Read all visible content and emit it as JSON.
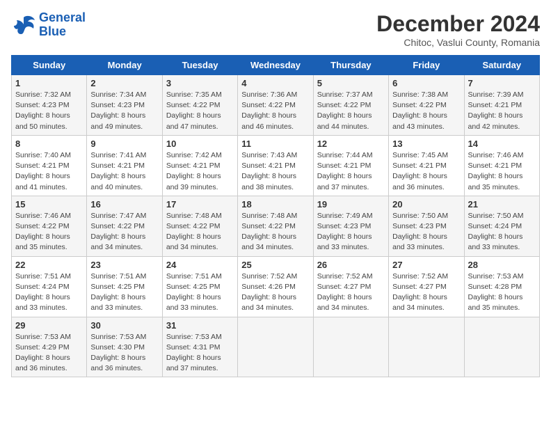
{
  "header": {
    "logo_line1": "General",
    "logo_line2": "Blue",
    "month": "December 2024",
    "location": "Chitoc, Vaslui County, Romania"
  },
  "days_of_week": [
    "Sunday",
    "Monday",
    "Tuesday",
    "Wednesday",
    "Thursday",
    "Friday",
    "Saturday"
  ],
  "weeks": [
    [
      {
        "num": "1",
        "info": "Sunrise: 7:32 AM\nSunset: 4:23 PM\nDaylight: 8 hours\nand 50 minutes."
      },
      {
        "num": "2",
        "info": "Sunrise: 7:34 AM\nSunset: 4:23 PM\nDaylight: 8 hours\nand 49 minutes."
      },
      {
        "num": "3",
        "info": "Sunrise: 7:35 AM\nSunset: 4:22 PM\nDaylight: 8 hours\nand 47 minutes."
      },
      {
        "num": "4",
        "info": "Sunrise: 7:36 AM\nSunset: 4:22 PM\nDaylight: 8 hours\nand 46 minutes."
      },
      {
        "num": "5",
        "info": "Sunrise: 7:37 AM\nSunset: 4:22 PM\nDaylight: 8 hours\nand 44 minutes."
      },
      {
        "num": "6",
        "info": "Sunrise: 7:38 AM\nSunset: 4:22 PM\nDaylight: 8 hours\nand 43 minutes."
      },
      {
        "num": "7",
        "info": "Sunrise: 7:39 AM\nSunset: 4:21 PM\nDaylight: 8 hours\nand 42 minutes."
      }
    ],
    [
      {
        "num": "8",
        "info": "Sunrise: 7:40 AM\nSunset: 4:21 PM\nDaylight: 8 hours\nand 41 minutes."
      },
      {
        "num": "9",
        "info": "Sunrise: 7:41 AM\nSunset: 4:21 PM\nDaylight: 8 hours\nand 40 minutes."
      },
      {
        "num": "10",
        "info": "Sunrise: 7:42 AM\nSunset: 4:21 PM\nDaylight: 8 hours\nand 39 minutes."
      },
      {
        "num": "11",
        "info": "Sunrise: 7:43 AM\nSunset: 4:21 PM\nDaylight: 8 hours\nand 38 minutes."
      },
      {
        "num": "12",
        "info": "Sunrise: 7:44 AM\nSunset: 4:21 PM\nDaylight: 8 hours\nand 37 minutes."
      },
      {
        "num": "13",
        "info": "Sunrise: 7:45 AM\nSunset: 4:21 PM\nDaylight: 8 hours\nand 36 minutes."
      },
      {
        "num": "14",
        "info": "Sunrise: 7:46 AM\nSunset: 4:21 PM\nDaylight: 8 hours\nand 35 minutes."
      }
    ],
    [
      {
        "num": "15",
        "info": "Sunrise: 7:46 AM\nSunset: 4:22 PM\nDaylight: 8 hours\nand 35 minutes."
      },
      {
        "num": "16",
        "info": "Sunrise: 7:47 AM\nSunset: 4:22 PM\nDaylight: 8 hours\nand 34 minutes."
      },
      {
        "num": "17",
        "info": "Sunrise: 7:48 AM\nSunset: 4:22 PM\nDaylight: 8 hours\nand 34 minutes."
      },
      {
        "num": "18",
        "info": "Sunrise: 7:48 AM\nSunset: 4:22 PM\nDaylight: 8 hours\nand 34 minutes."
      },
      {
        "num": "19",
        "info": "Sunrise: 7:49 AM\nSunset: 4:23 PM\nDaylight: 8 hours\nand 33 minutes."
      },
      {
        "num": "20",
        "info": "Sunrise: 7:50 AM\nSunset: 4:23 PM\nDaylight: 8 hours\nand 33 minutes."
      },
      {
        "num": "21",
        "info": "Sunrise: 7:50 AM\nSunset: 4:24 PM\nDaylight: 8 hours\nand 33 minutes."
      }
    ],
    [
      {
        "num": "22",
        "info": "Sunrise: 7:51 AM\nSunset: 4:24 PM\nDaylight: 8 hours\nand 33 minutes."
      },
      {
        "num": "23",
        "info": "Sunrise: 7:51 AM\nSunset: 4:25 PM\nDaylight: 8 hours\nand 33 minutes."
      },
      {
        "num": "24",
        "info": "Sunrise: 7:51 AM\nSunset: 4:25 PM\nDaylight: 8 hours\nand 33 minutes."
      },
      {
        "num": "25",
        "info": "Sunrise: 7:52 AM\nSunset: 4:26 PM\nDaylight: 8 hours\nand 34 minutes."
      },
      {
        "num": "26",
        "info": "Sunrise: 7:52 AM\nSunset: 4:27 PM\nDaylight: 8 hours\nand 34 minutes."
      },
      {
        "num": "27",
        "info": "Sunrise: 7:52 AM\nSunset: 4:27 PM\nDaylight: 8 hours\nand 34 minutes."
      },
      {
        "num": "28",
        "info": "Sunrise: 7:53 AM\nSunset: 4:28 PM\nDaylight: 8 hours\nand 35 minutes."
      }
    ],
    [
      {
        "num": "29",
        "info": "Sunrise: 7:53 AM\nSunset: 4:29 PM\nDaylight: 8 hours\nand 36 minutes."
      },
      {
        "num": "30",
        "info": "Sunrise: 7:53 AM\nSunset: 4:30 PM\nDaylight: 8 hours\nand 36 minutes."
      },
      {
        "num": "31",
        "info": "Sunrise: 7:53 AM\nSunset: 4:31 PM\nDaylight: 8 hours\nand 37 minutes."
      },
      null,
      null,
      null,
      null
    ]
  ]
}
